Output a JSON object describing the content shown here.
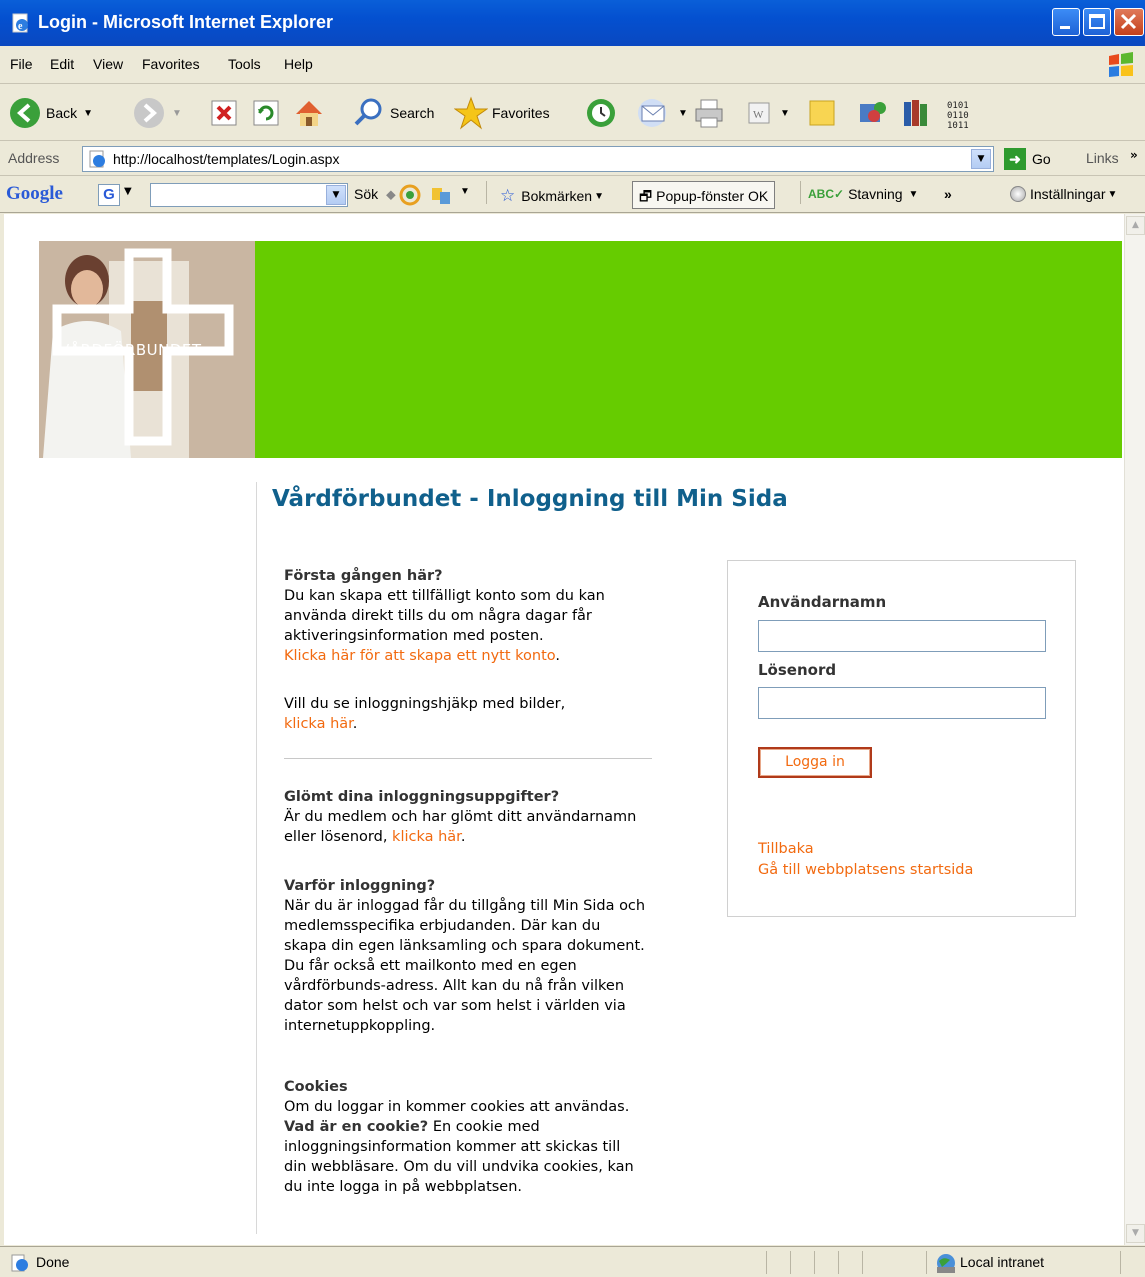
{
  "window": {
    "title": "Login - Microsoft Internet Explorer"
  },
  "menu": [
    "File",
    "Edit",
    "View",
    "Favorites",
    "Tools",
    "Help"
  ],
  "toolbar": {
    "back": "Back",
    "search": "Search",
    "favorites": "Favorites"
  },
  "address": {
    "label": "Address",
    "url": "http://localhost/templates/Login.aspx",
    "go": "Go",
    "links": "Links"
  },
  "googlebar": {
    "logo": "Google",
    "sok": "Sök",
    "bokmarken": "Bokmärken",
    "popup": "Popup-fönster OK",
    "stavning": "Stavning",
    "installningar": "Inställningar"
  },
  "banner": {
    "brand": "VÅRDFÖRBUNDET",
    "color": "#66cc00"
  },
  "page": {
    "title": "Vårdförbundet - Inloggning till Min Sida",
    "first_time": {
      "heading": "Första gången här?",
      "text": "Du kan skapa ett tillfälligt konto som du kan använda direkt tills du om några dagar får aktiveringsinformation med posten.",
      "link": "Klicka här för att skapa ett nytt konto",
      "after": "."
    },
    "help": {
      "text": "Vill du se inloggningshjäkp med bilder,",
      "link": "klicka här",
      "after": "."
    },
    "forgot": {
      "heading": "Glömt dina inloggningsuppgifter?",
      "text": "Är du medlem och har glömt ditt användarnamn eller lösenord,",
      "link": "klicka här",
      "after": "."
    },
    "why": {
      "heading": "Varför inloggning?",
      "text": "När du är inloggad får du tillgång till Min Sida och medlemsspecifika erbjudanden. Där kan du skapa din egen länksamling och spara dokument. Du får också ett mailkonto med en egen vårdförbunds-adress. Allt kan du nå från vilken dator som helst och var som helst i världen via internetuppkoppling."
    },
    "cookies": {
      "heading": "Cookies",
      "text1": "Om du loggar in kommer cookies att användas.",
      "bold": "Vad är en cookie?",
      "text2": "En cookie med inloggningsinformation kommer att skickas till din webbläsare. Om du vill undvika cookies, kan du inte logga in på webbplatsen."
    }
  },
  "login": {
    "username_label": "Användarnamn",
    "username_value": "",
    "password_label": "Lösenord",
    "password_value": "",
    "button": "Logga in",
    "back_link": "Tillbaka",
    "home_link": "Gå till webbplatsens startsida"
  },
  "status": {
    "text": "Done",
    "zone": "Local intranet"
  }
}
